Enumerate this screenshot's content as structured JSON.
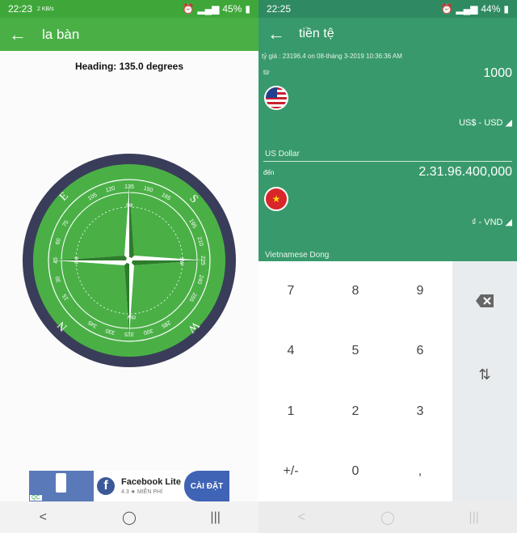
{
  "left": {
    "status": {
      "time": "22:23",
      "small": "2 KB/s",
      "battery": "45%"
    },
    "appbar": {
      "title": "la bàn"
    },
    "heading": "Heading: 135.0 degrees",
    "compass": {
      "cardinals": {
        "north": "N",
        "east": "E",
        "south": "S",
        "west": "W"
      },
      "inner": {
        "se": "se",
        "ne": "ne",
        "sw": "sw",
        "nw": "nw"
      },
      "degrees": [
        "105",
        "120",
        "135",
        "150",
        "165",
        "195",
        "210",
        "225",
        "240",
        "255",
        "285",
        "300",
        "315",
        "330",
        "345",
        "15",
        "30",
        "45",
        "60",
        "75"
      ],
      "colors": {
        "ring": "#3a3d59",
        "face": "#4ab046"
      }
    },
    "ad": {
      "app": "Facebook Lite",
      "rating": "4.3 ★ MIỄN PHÍ",
      "install": "CÀI ĐẶT",
      "qc": "QC"
    },
    "nav": {
      "back": "<",
      "home": "◯",
      "recent": "|||"
    }
  },
  "right": {
    "status": {
      "time": "22:25",
      "battery": "44%"
    },
    "appbar": {
      "title": "tiền tệ"
    },
    "rate": "tỷ giá : 23196.4 on 08-tháng 3-2019 10:36:36 AM",
    "from": {
      "label": "từ",
      "value": "1000",
      "currency": "US$ - USD ◢",
      "name": "US Dollar"
    },
    "to": {
      "label": "đến",
      "value": "2.31.96.400,000",
      "currency": "₫ - VND ◢",
      "name": "Vietnamese Dong"
    },
    "keypad": [
      "7",
      "8",
      "9",
      "4",
      "5",
      "6",
      "1",
      "2",
      "3",
      "+/-",
      "0",
      ","
    ],
    "swap": "⇅",
    "nav": {
      "back": "<",
      "home": "◯",
      "recent": "|||"
    }
  }
}
